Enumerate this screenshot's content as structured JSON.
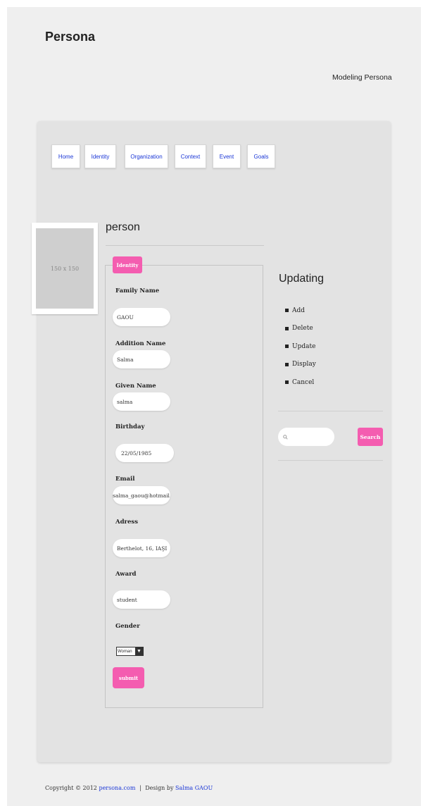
{
  "header": {
    "site_title": "Persona",
    "tagline": "Modeling Persona"
  },
  "nav": {
    "items": [
      "Home",
      "Identity",
      "Organization",
      "Context",
      "Event",
      "Goals"
    ]
  },
  "avatar": {
    "placeholder": "150 x 150"
  },
  "form": {
    "section_title": "person",
    "legend": "Identity",
    "fields": {
      "family_name": {
        "label": "Family Name",
        "value": "GAOU"
      },
      "addition_name": {
        "label": "Addition Name",
        "value": "Salma"
      },
      "given_name": {
        "label": "Given Name",
        "value": "salma"
      },
      "birthday": {
        "label": "Birthday",
        "value": "22/05/1985"
      },
      "email": {
        "label": "Email",
        "value": "salma_gaou@hotmail.fr"
      },
      "address": {
        "label": "Adress",
        "value": "Berthelot, 16, IAŞI"
      },
      "award": {
        "label": "Award",
        "value": "student"
      },
      "gender": {
        "label": "Gender",
        "value": "Woman"
      }
    },
    "submit_label": "submit"
  },
  "sidebar": {
    "title": "Updating",
    "items": [
      "Add",
      "Delete",
      "Update",
      "Display",
      "Cancel"
    ],
    "search_button": "Search"
  },
  "footer": {
    "copyright": "Copyright © 2012",
    "site_link": "persona.com",
    "separator": "|",
    "design_by": "Design by",
    "author_link": "Salma GAOU"
  },
  "colors": {
    "accent_pink": "#f45db0",
    "link_blue": "#1a36d6",
    "panel_gray": "#e3e3e3",
    "page_gray": "#efefef"
  }
}
